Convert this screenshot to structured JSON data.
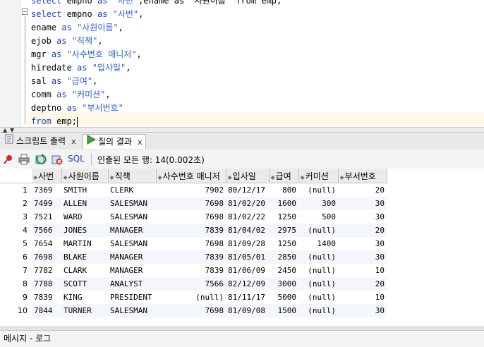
{
  "editor": {
    "lines": [
      {
        "pre": "",
        "kw": "select",
        "mid": " empno ",
        "kw2": "as",
        "str": " \"사번\"",
        "tail": ",ename as \"사원이름\" from emp;"
      },
      {
        "pre": "",
        "kw": "select",
        "mid": " empno ",
        "kw2": "as",
        "str": " \"사번\"",
        "tail": ","
      },
      {
        "pre": "",
        "kw": "",
        "mid": "ename ",
        "kw2": "as",
        "str": " \"사원이름\"",
        "tail": ","
      },
      {
        "pre": "",
        "kw": "",
        "mid": "ejob ",
        "kw2": "as",
        "str": " \"직책\"",
        "tail": ","
      },
      {
        "pre": "",
        "kw": "",
        "mid": "mgr ",
        "kw2": "as",
        "str": " \"사수번호 매니저\"",
        "tail": ","
      },
      {
        "pre": "",
        "kw": "",
        "mid": "hiredate ",
        "kw2": "as",
        "str": " \"입사일\"",
        "tail": ","
      },
      {
        "pre": "",
        "kw": "",
        "mid": "sal ",
        "kw2": "as",
        "str": " \"급여\"",
        "tail": ","
      },
      {
        "pre": "",
        "kw": "",
        "mid": "comm ",
        "kw2": "as",
        "str": " \"커미션\"",
        "tail": ","
      },
      {
        "pre": "",
        "kw": "",
        "mid": "deptno ",
        "kw2": "as",
        "str": " \"부서번호\"",
        "tail": ""
      },
      {
        "pre": "",
        "kw": "from",
        "mid": " emp;",
        "kw2": "",
        "str": "",
        "tail": ""
      }
    ]
  },
  "tabs": [
    {
      "label": "스크립트 출력",
      "close": "x",
      "icon": "script-output-icon"
    },
    {
      "label": "질의 결과",
      "close": "x",
      "icon": "run-triangle-icon"
    }
  ],
  "toolbar": {
    "sql_label": "SQL",
    "status": "인출된 모든 행: 14(0.002초)",
    "icons": [
      "pin-icon",
      "print-icon",
      "refresh-icon",
      "cancel-icon"
    ]
  },
  "grid": {
    "columns": [
      "사번",
      "사원이름",
      "직책",
      "사수번호 매니저",
      "입사일",
      "급여",
      "커미션",
      "부서번호"
    ],
    "rows": [
      [
        "1",
        "7369",
        "SMITH",
        "CLERK",
        "7902",
        "80/12/17",
        "800",
        "(null)",
        "20"
      ],
      [
        "2",
        "7499",
        "ALLEN",
        "SALESMAN",
        "7698",
        "81/02/20",
        "1600",
        "300",
        "30"
      ],
      [
        "3",
        "7521",
        "WARD",
        "SALESMAN",
        "7698",
        "81/02/22",
        "1250",
        "500",
        "30"
      ],
      [
        "4",
        "7566",
        "JONES",
        "MANAGER",
        "7839",
        "81/04/02",
        "2975",
        "(null)",
        "20"
      ],
      [
        "5",
        "7654",
        "MARTIN",
        "SALESMAN",
        "7698",
        "81/09/28",
        "1250",
        "1400",
        "30"
      ],
      [
        "6",
        "7698",
        "BLAKE",
        "MANAGER",
        "7839",
        "81/05/01",
        "2850",
        "(null)",
        "30"
      ],
      [
        "7",
        "7782",
        "CLARK",
        "MANAGER",
        "7839",
        "81/06/09",
        "2450",
        "(null)",
        "10"
      ],
      [
        "8",
        "7788",
        "SCOTT",
        "ANALYST",
        "7566",
        "82/12/09",
        "3000",
        "(null)",
        "20"
      ],
      [
        "9",
        "7839",
        "KING",
        "PRESIDENT",
        "(null)",
        "81/11/17",
        "5000",
        "(null)",
        "10"
      ],
      [
        "10",
        "7844",
        "TURNER",
        "SALESMAN",
        "7698",
        "81/09/08",
        "1500",
        "(null)",
        "30"
      ]
    ]
  },
  "message_bar": {
    "label": "메시지 - 로그"
  },
  "colors": {
    "keyword": "#1f3fbf",
    "string": "#2a5fd6",
    "current_line": "#fff8e6"
  }
}
